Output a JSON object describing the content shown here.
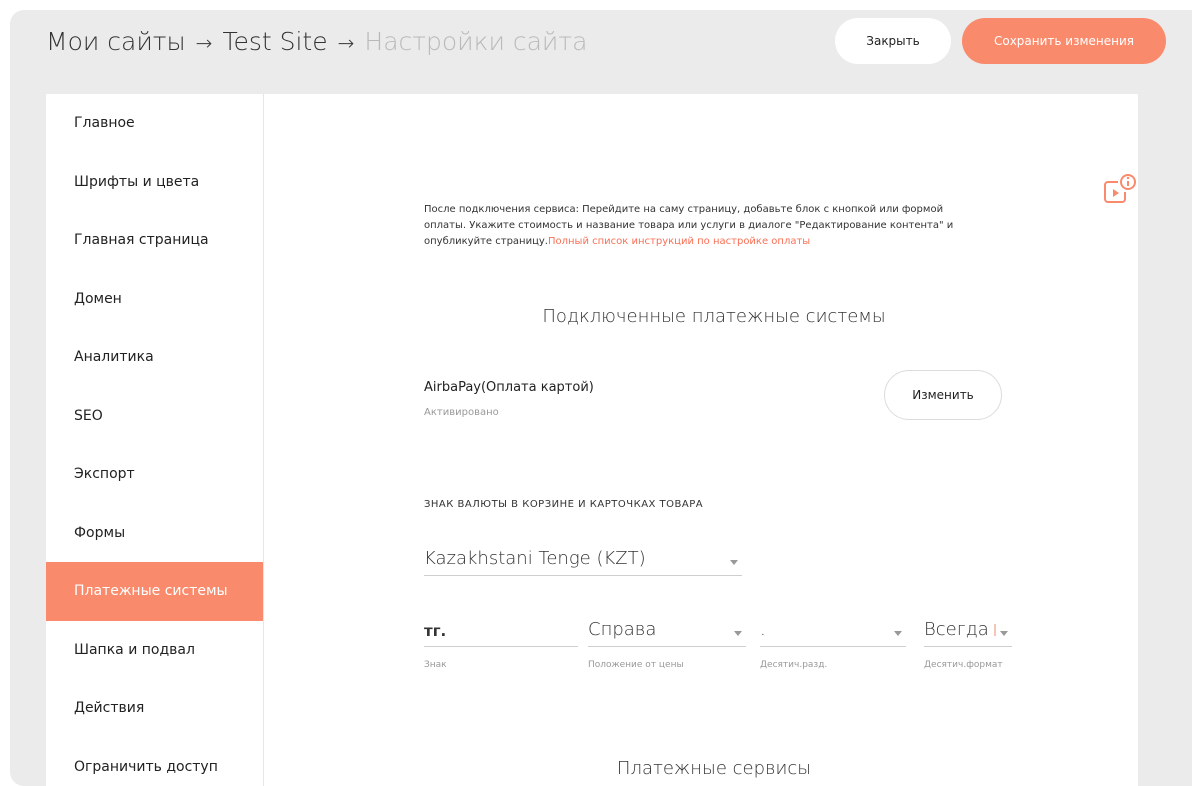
{
  "header": {
    "breadcrumb": [
      "Мои сайты",
      "Test Site",
      "Настройки сайта"
    ],
    "arrow": "→",
    "close_label": "Закрыть",
    "save_label": "Сохранить изменения"
  },
  "sidebar": {
    "items": [
      {
        "label": "Главное"
      },
      {
        "label": "Шрифты и цвета"
      },
      {
        "label": "Главная страница"
      },
      {
        "label": "Домен"
      },
      {
        "label": "Аналитика"
      },
      {
        "label": "SEO"
      },
      {
        "label": "Экспорт"
      },
      {
        "label": "Формы"
      },
      {
        "label": "Платежные системы"
      },
      {
        "label": "Шапка и подвал"
      },
      {
        "label": "Действия"
      },
      {
        "label": "Ограничить доступ"
      }
    ],
    "active_index": 8
  },
  "main": {
    "intro_text": "После подключения сервиса: Перейдите на саму страницу, добавьте блок с кнопкой или формой оплаты. Укажите стоимость и название товара или услуги в диалоге \"Редактирование контента\" и опубликуйте страницу.",
    "intro_link": "Полный список инструкций по настройке оплаты",
    "connected_title": "Подключенные платежные системы",
    "payment": {
      "name": "AirbaPay(Оплата картой)",
      "status": "Активировано",
      "edit_label": "Изменить"
    },
    "currency_section_label": "ЗНАК ВАЛЮТЫ В КОРЗИНЕ И КАРТОЧКАХ ТОВАРА",
    "currency_select": "Kazakhstani Tenge (KZT)",
    "sign": {
      "value": "тг.",
      "label": "Знак"
    },
    "position": {
      "value": "Справа",
      "label": "Положение от цены"
    },
    "decimal_separator": {
      "value": ".",
      "label": "Десятич.разд."
    },
    "decimal_format": {
      "value": "Всегда",
      "label": "Десятич.формат"
    },
    "services_title": "Платежные сервисы"
  },
  "colors": {
    "accent": "#fa8a6c",
    "link": "#fa6f55",
    "background": "#ebebeb"
  },
  "icons": {
    "video_help": "video-info-icon"
  }
}
